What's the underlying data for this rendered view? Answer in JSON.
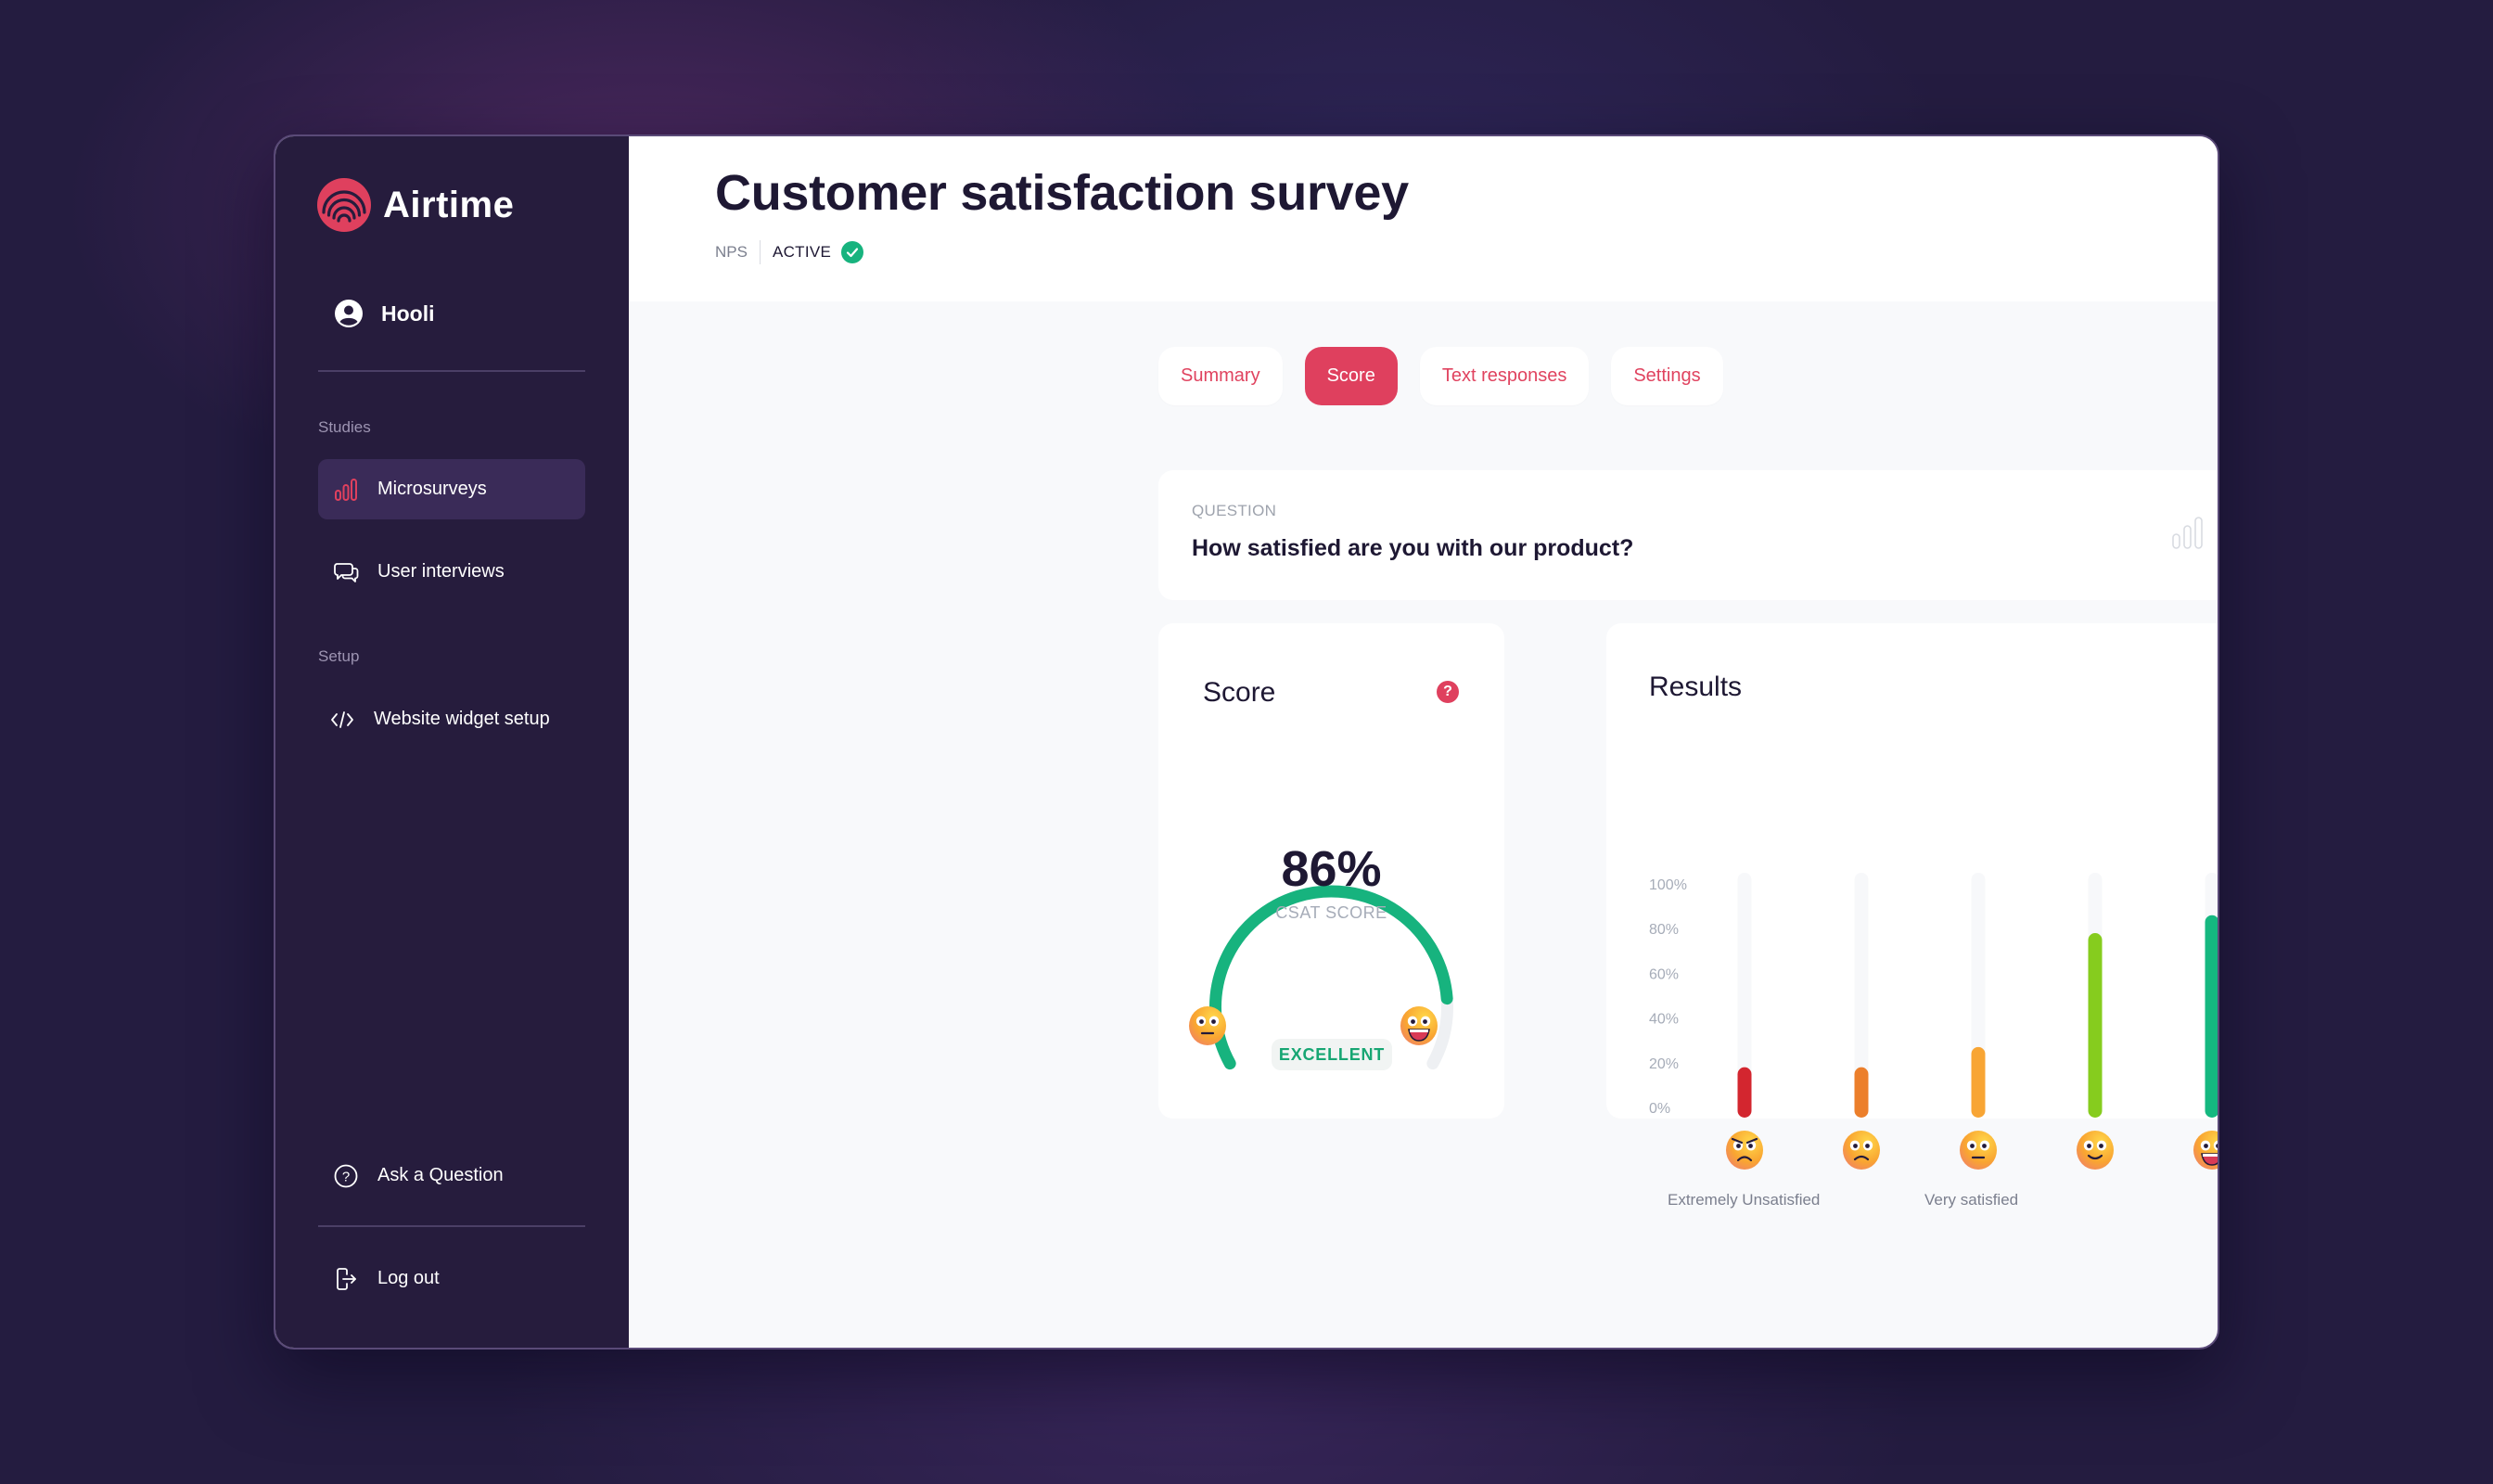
{
  "app": {
    "name": "Airtime",
    "brand_color": "#df405e"
  },
  "sidebar": {
    "account": {
      "name": "Hooli",
      "icon": "user-circle-icon"
    },
    "sections": [
      {
        "label": "Studies",
        "items": [
          {
            "label": "Microsurveys",
            "icon": "bar-chart-icon",
            "active": true
          },
          {
            "label": "User interviews",
            "icon": "chat-bubbles-icon",
            "active": false
          }
        ]
      },
      {
        "label": "Setup",
        "items": [
          {
            "label": "Website widget setup",
            "icon": "code-icon",
            "active": false
          }
        ]
      }
    ],
    "footer": [
      {
        "label": "Ask a Question",
        "icon": "question-circle-icon"
      },
      {
        "label": "Log out",
        "icon": "logout-icon"
      }
    ]
  },
  "header": {
    "title": "Customer satisfaction survey",
    "type": "NPS",
    "status": "ACTIVE",
    "status_icon": "check-circle-icon",
    "status_color": "#17b37e"
  },
  "tabs": [
    {
      "label": "Summary",
      "active": false
    },
    {
      "label": "Score",
      "active": true
    },
    {
      "label": "Text responses",
      "active": false
    },
    {
      "label": "Settings",
      "active": false
    }
  ],
  "question": {
    "label": "QUESTION",
    "text": "How satisfied are you with our product?",
    "icon": "bar-chart-icon"
  },
  "score": {
    "title": "Score",
    "help_icon": "?",
    "value": 86,
    "value_label": "86%",
    "sub_label": "CSAT SCORE",
    "rating": "EXCELLENT",
    "gauge_color": "#17b37e",
    "left_emoji": "neutral-face",
    "right_emoji": "grinning-face"
  },
  "results": {
    "title": "Results",
    "low_label": "Extremely Unsatisfied",
    "high_label": "Very satisfied"
  },
  "chart_data": {
    "type": "bar",
    "title": "Results",
    "xlabel": "",
    "ylabel": "",
    "ylim": [
      0,
      100
    ],
    "yticks": [
      "100%",
      "80%",
      "60%",
      "40%",
      "20%",
      "0%"
    ],
    "grid": false,
    "categories": [
      "angry-face",
      "frowning-face",
      "neutral-face",
      "smiling-face",
      "grinning-face"
    ],
    "values": [
      18,
      18,
      27,
      78,
      86
    ],
    "colors": [
      "#d3262f",
      "#ec7f2b",
      "#f8a534",
      "#86cc1e",
      "#15b880"
    ],
    "axis_end_labels": [
      "Extremely Unsatisfied",
      "Very satisfied"
    ]
  }
}
